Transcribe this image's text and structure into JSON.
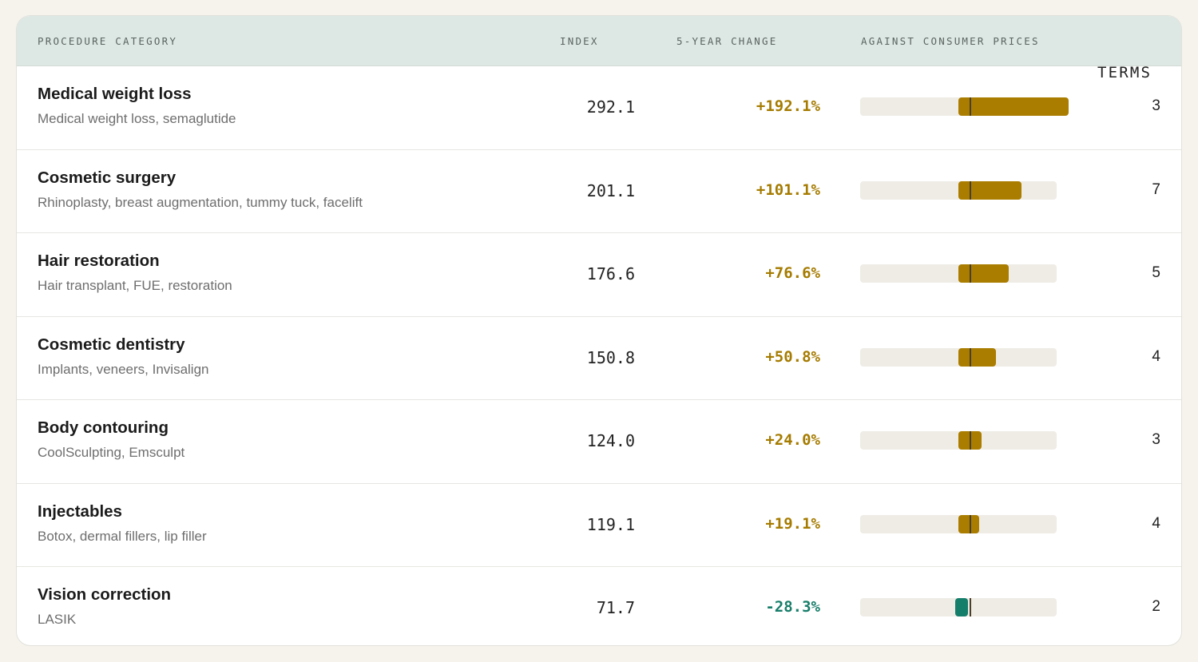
{
  "header": {
    "category": "PROCEDURE CATEGORY",
    "index": "INDEX",
    "change": "5-YEAR CHANGE",
    "cpi": "AGAINST CONSUMER PRICES",
    "terms": "TERMS"
  },
  "colors": {
    "up": "#aa7d00",
    "down": "#157e6b",
    "header_bg": "#dde7e3"
  },
  "rows": [
    {
      "name": "Medical weight loss",
      "sub": "Medical weight loss, semaglutide",
      "index": "292.1",
      "change": "+192.1%",
      "dir": "up",
      "index_value": 292.1,
      "terms": "3"
    },
    {
      "name": "Cosmetic surgery",
      "sub": "Rhinoplasty, breast augmentation, tummy tuck, facelift",
      "index": "201.1",
      "change": "+101.1%",
      "dir": "up",
      "index_value": 201.1,
      "terms": "7"
    },
    {
      "name": "Hair restoration",
      "sub": "Hair transplant, FUE, restoration",
      "index": "176.6",
      "change": "+76.6%",
      "dir": "up",
      "index_value": 176.6,
      "terms": "5"
    },
    {
      "name": "Cosmetic dentistry",
      "sub": "Implants, veneers, Invisalign",
      "index": "150.8",
      "change": "+50.8%",
      "dir": "up",
      "index_value": 150.8,
      "terms": "4"
    },
    {
      "name": "Body contouring",
      "sub": "CoolSculpting, Emsculpt",
      "index": "124.0",
      "change": "+24.0%",
      "dir": "up",
      "index_value": 124.0,
      "terms": "3"
    },
    {
      "name": "Injectables",
      "sub": "Botox, dermal fillers, lip filler",
      "index": "119.1",
      "change": "+19.1%",
      "dir": "up",
      "index_value": 119.1,
      "terms": "4"
    },
    {
      "name": "Vision correction",
      "sub": "LASIK",
      "index": "71.7",
      "change": "-28.3%",
      "dir": "down",
      "index_value": 71.7,
      "terms": "2"
    }
  ]
}
